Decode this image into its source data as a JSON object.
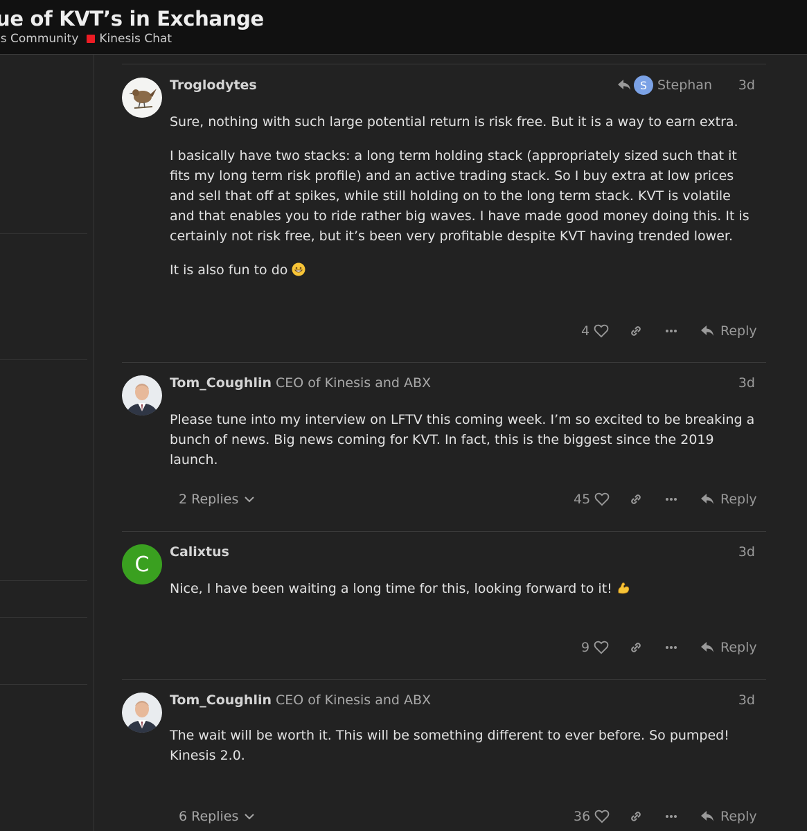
{
  "header": {
    "title": "ue of KVT’s in Exchange",
    "breadcrumb_parent": "is Community",
    "breadcrumb_category": "Kinesis Chat",
    "category_color": "#ed1c24"
  },
  "posts": [
    {
      "username": "Troglodytes",
      "user_title": "",
      "reply_to_initial": "S",
      "reply_to_name": "Stephan",
      "date": "3d",
      "paragraphs": [
        "Sure, nothing with such large potential return is risk free. But it is a way to earn extra.",
        "I basically have two stacks: a long term holding stack (appropriately sized such that it fits my long term risk profile) and an active trading stack. So I buy extra at low prices and sell that off at spikes, while still holding on to the long term stack. KVT is volatile and that enables you to ride rather big waves. I have made good money doing this. It is certainly not risk free, but it’s been very profitable despite KVT having trended lower.",
        "It is also fun to do"
      ],
      "likes": "4",
      "reply_label": "Reply"
    },
    {
      "username": "Tom_Coughlin",
      "user_title": "CEO of Kinesis and ABX",
      "date": "3d",
      "paragraphs": [
        "Please tune into my interview on LFTV this coming week. I’m so excited to be breaking a bunch of news. Big news coming for KVT. In fact, this is the biggest since the 2019 launch."
      ],
      "replies": "2 Replies",
      "likes": "45",
      "reply_label": "Reply"
    },
    {
      "username": "Calixtus",
      "user_title": "",
      "avatar_letter": "C",
      "avatar_color": "#3aa020",
      "date": "3d",
      "paragraphs": [
        "Nice, I have been waiting a long time for this, looking forward to it!"
      ],
      "likes": "9",
      "reply_label": "Reply"
    },
    {
      "username": "Tom_Coughlin",
      "user_title": "CEO of Kinesis and ABX",
      "date": "3d",
      "paragraphs": [
        "The wait will be worth it. This will be something different to ever before. So pumped! Kinesis 2.0."
      ],
      "replies": "6 Replies",
      "likes": "36",
      "reply_label": "Reply"
    }
  ]
}
